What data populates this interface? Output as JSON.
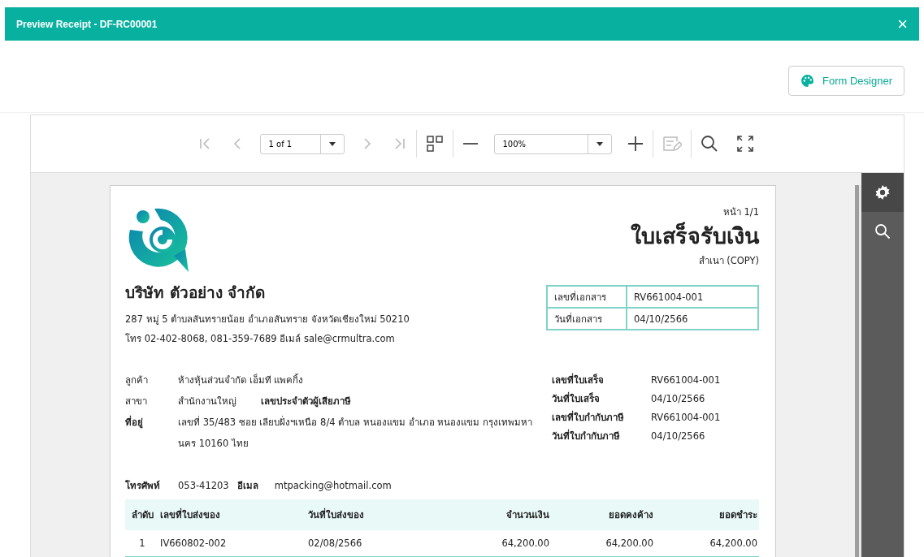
{
  "window": {
    "title": "Preview Receipt - DF-RC00001",
    "close": "×"
  },
  "form_designer_button": "Form Designer",
  "toolbar": {
    "page_select": "1 of 1",
    "zoom_select": "100%"
  },
  "side_panel": [
    {
      "kind": "settings",
      "selected": true
    },
    {
      "kind": "search",
      "selected": false
    }
  ],
  "document": {
    "page": "หน้า 1/1",
    "title": "ใบเสร็จรับเงิน",
    "copy": "สำเนา (COPY)",
    "company": {
      "name": "บริษัท ตัวอย่าง จำกัด",
      "address": "287 หมู่ 5 ตำบลสันทรายน้อย อำเภอสันทราย จังหวัดเชียงใหม่ 50210",
      "contact": "โทร 02-402-8068, 081-359-7689 อีเมล์ sale@crmultra.com"
    },
    "doc_info": [
      {
        "label": "เลขที่เอกสาร",
        "value": "RV661004-001"
      },
      {
        "label": "วันที่เอกสาร",
        "value": "04/10/2566"
      }
    ],
    "customer": {
      "customer_label": "ลูกค้า",
      "customer": "ห้างหุ้นส่วนจำกัด เอ็มที แพคกิ้ง",
      "branch_label": "สาขา",
      "branch": "สำนักงานใหญ่",
      "tax_id_label": "เลขประจำตัวผู้เสียภาษี",
      "address_label": "ที่อยู่",
      "address_lines": [
        "เลขที่ 35/483 ซอย เลียบฝั่งฯเหนือ 8/4 ตำบล หนองแขม อำเภอ หนองแขม กรุงเทพมหา",
        "นคร 10160 ไทย"
      ],
      "phone_label": "โทรศัพท์",
      "phone": "053-41203",
      "email_label": "อีเมล",
      "email": "mtpacking@hotmail.com"
    },
    "receipt_info": [
      {
        "label": "เลขที่ใบเสร็จ",
        "value": "RV661004-001"
      },
      {
        "label": "วันที่ใบเสร็จ",
        "value": "04/10/2566"
      },
      {
        "label": "เลขที่ใบกำกับภาษี",
        "value": "RV661004-001"
      },
      {
        "label": "วันที่ใบกำกับภาษี",
        "value": "04/10/2566"
      }
    ],
    "table": {
      "columns": [
        "ลำดับ",
        "เลขที่ใบส่งของ",
        "วันที่ใบส่งของ",
        "จำนวนเงิน",
        "ยอดคงค้าง",
        "ยอดชำระ"
      ],
      "rows": [
        [
          "1",
          "IV660802-002",
          "02/08/2566",
          "64,200.00",
          "64,200.00",
          "64,200.00"
        ]
      ]
    }
  }
}
